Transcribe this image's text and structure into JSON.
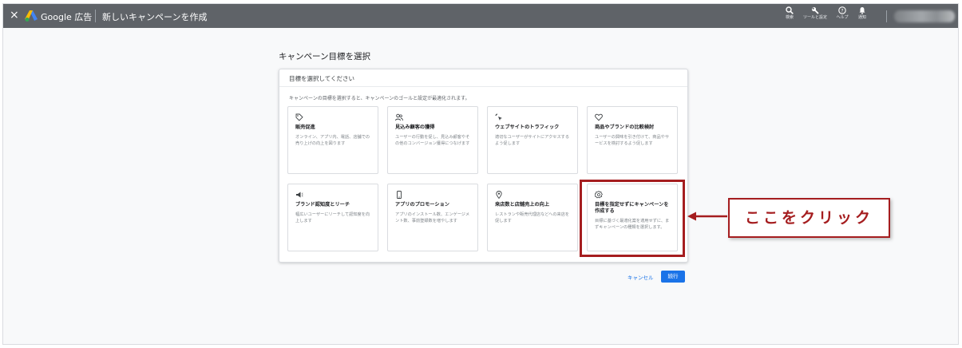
{
  "topbar": {
    "close": "×",
    "brand": "Google 広告",
    "page_name": "新しいキャンペーンを作成",
    "tools": [
      {
        "icon": "search-icon",
        "label": "検索"
      },
      {
        "icon": "wrench-icon",
        "label": "ツールと設定"
      },
      {
        "icon": "help-icon",
        "label": "ヘルプ"
      },
      {
        "icon": "bell-icon",
        "label": "通知"
      }
    ]
  },
  "main": {
    "title": "キャンペーン目標を選択",
    "panel_header": "目標を選択してください",
    "panel_desc": "キャンペーンの目標を選択すると、キャンペーンのゴールと設定が最適化されます。",
    "cards": [
      {
        "icon": "tag-icon",
        "title": "販売促進",
        "desc": "オンライン、アプリ内、電話、店舗での売り上げの向上を図ります"
      },
      {
        "icon": "people-icon",
        "title": "見込み顧客の獲得",
        "desc": "ユーザーの行動を促し、見込み顧客やその他のコンバージョン獲得につなげます"
      },
      {
        "icon": "click-icon",
        "title": "ウェブサイトのトラフィック",
        "desc": "適切なユーザーがサイトにアクセスするよう促します"
      },
      {
        "icon": "heart-icon",
        "title": "商品やブランドの比較検討",
        "desc": "ユーザーの興味を引き付けて、商品やサービスを検討するよう促します"
      },
      {
        "icon": "megaphone-icon",
        "title": "ブランド認知度とリーチ",
        "desc": "幅広いユーザーにリーチして認知度を向上します"
      },
      {
        "icon": "phone-icon",
        "title": "アプリのプロモーション",
        "desc": "アプリのインストール数、エンゲージメント数、事前登録数を増やします"
      },
      {
        "icon": "location-pin-icon",
        "title": "来店数と店舗売上の向上",
        "desc": "レストランや販売代理店などへの来店を促します"
      },
      {
        "icon": "gear-icon",
        "title": "目標を指定せずにキャンペーンを作成する",
        "desc": "目標に基づく最適化案を適用せずに、まずキャンペーンの種類を選択します。"
      }
    ]
  },
  "actions": {
    "cancel": "キャンセル",
    "next": "続行"
  },
  "annotation": {
    "callout": "ここをクリック",
    "color": "#a51d1f"
  },
  "colors": {
    "topbar": "#5f6368",
    "accent": "#1a73e8"
  }
}
